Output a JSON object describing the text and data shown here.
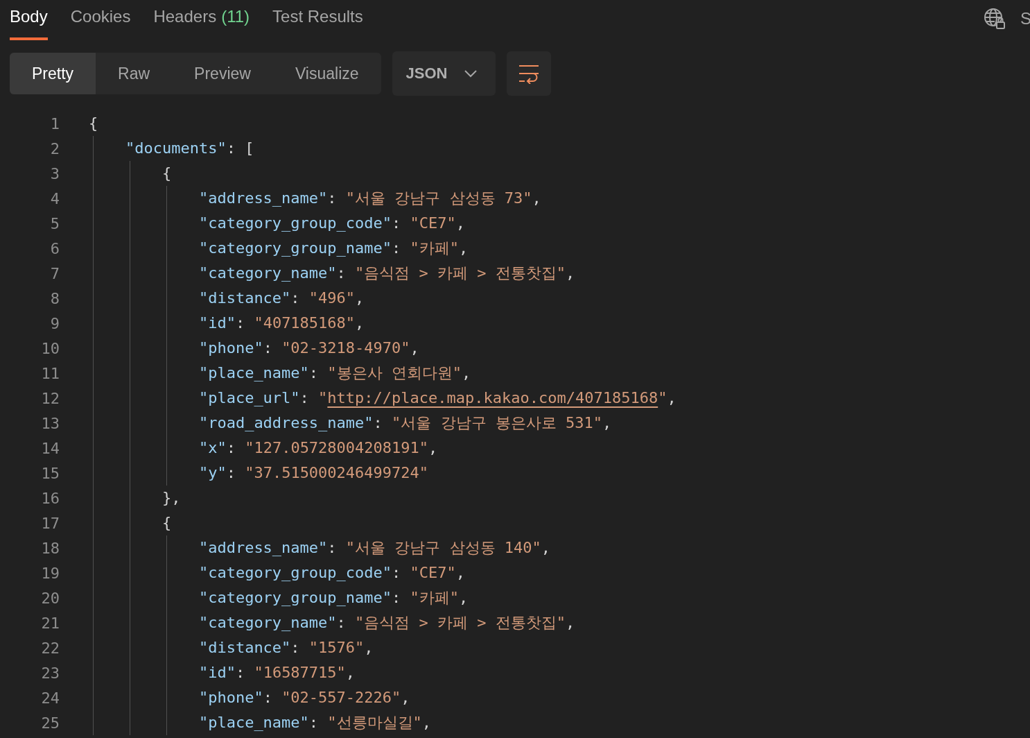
{
  "response_tabs": [
    {
      "label": "Body",
      "selected": true
    },
    {
      "label": "Cookies",
      "selected": false
    },
    {
      "label": "Headers",
      "count": "(11)",
      "selected": false
    },
    {
      "label": "Test Results",
      "selected": false
    }
  ],
  "right_text": "S",
  "view_modes": [
    {
      "label": "Pretty",
      "selected": true
    },
    {
      "label": "Raw",
      "selected": false
    },
    {
      "label": "Preview",
      "selected": false
    },
    {
      "label": "Visualize",
      "selected": false
    }
  ],
  "format_dropdown": {
    "value": "JSON"
  },
  "code_lines": [
    {
      "number": "1",
      "tokens": [
        {
          "kind": "punct",
          "text": "{"
        }
      ],
      "children": [
        {
          "number": "2",
          "tokens": [
            {
              "kind": "key",
              "text": "\"documents\""
            },
            {
              "kind": "punct",
              "text": ": ["
            }
          ],
          "children": [
            {
              "number": "3",
              "tokens": [
                {
                  "kind": "punct",
                  "text": "{"
                }
              ],
              "children": [
                {
                  "number": "4",
                  "tokens": [
                    {
                      "kind": "key",
                      "text": "\"address_name\""
                    },
                    {
                      "kind": "punct",
                      "text": ": "
                    },
                    {
                      "kind": "string",
                      "text": "\"서울 강남구 삼성동 73\""
                    },
                    {
                      "kind": "punct",
                      "text": ","
                    }
                  ]
                },
                {
                  "number": "5",
                  "tokens": [
                    {
                      "kind": "key",
                      "text": "\"category_group_code\""
                    },
                    {
                      "kind": "punct",
                      "text": ": "
                    },
                    {
                      "kind": "string",
                      "text": "\"CE7\""
                    },
                    {
                      "kind": "punct",
                      "text": ","
                    }
                  ]
                },
                {
                  "number": "6",
                  "tokens": [
                    {
                      "kind": "key",
                      "text": "\"category_group_name\""
                    },
                    {
                      "kind": "punct",
                      "text": ": "
                    },
                    {
                      "kind": "string",
                      "text": "\"카페\""
                    },
                    {
                      "kind": "punct",
                      "text": ","
                    }
                  ]
                },
                {
                  "number": "7",
                  "tokens": [
                    {
                      "kind": "key",
                      "text": "\"category_name\""
                    },
                    {
                      "kind": "punct",
                      "text": ": "
                    },
                    {
                      "kind": "string",
                      "text": "\"음식점 > 카페 > 전통찻집\""
                    },
                    {
                      "kind": "punct",
                      "text": ","
                    }
                  ]
                },
                {
                  "number": "8",
                  "tokens": [
                    {
                      "kind": "key",
                      "text": "\"distance\""
                    },
                    {
                      "kind": "punct",
                      "text": ": "
                    },
                    {
                      "kind": "string",
                      "text": "\"496\""
                    },
                    {
                      "kind": "punct",
                      "text": ","
                    }
                  ]
                },
                {
                  "number": "9",
                  "tokens": [
                    {
                      "kind": "key",
                      "text": "\"id\""
                    },
                    {
                      "kind": "punct",
                      "text": ": "
                    },
                    {
                      "kind": "string",
                      "text": "\"407185168\""
                    },
                    {
                      "kind": "punct",
                      "text": ","
                    }
                  ]
                },
                {
                  "number": "10",
                  "tokens": [
                    {
                      "kind": "key",
                      "text": "\"phone\""
                    },
                    {
                      "kind": "punct",
                      "text": ": "
                    },
                    {
                      "kind": "string",
                      "text": "\"02-3218-4970\""
                    },
                    {
                      "kind": "punct",
                      "text": ","
                    }
                  ]
                },
                {
                  "number": "11",
                  "tokens": [
                    {
                      "kind": "key",
                      "text": "\"place_name\""
                    },
                    {
                      "kind": "punct",
                      "text": ": "
                    },
                    {
                      "kind": "string",
                      "text": "\"봉은사 연회다원\""
                    },
                    {
                      "kind": "punct",
                      "text": ","
                    }
                  ]
                },
                {
                  "number": "12",
                  "tokens": [
                    {
                      "kind": "key",
                      "text": "\"place_url\""
                    },
                    {
                      "kind": "punct",
                      "text": ": "
                    },
                    {
                      "kind": "string",
                      "text": "\""
                    },
                    {
                      "kind": "link",
                      "text": "http://place.map.kakao.com/407185168"
                    },
                    {
                      "kind": "string",
                      "text": "\""
                    },
                    {
                      "kind": "punct",
                      "text": ","
                    }
                  ]
                },
                {
                  "number": "13",
                  "tokens": [
                    {
                      "kind": "key",
                      "text": "\"road_address_name\""
                    },
                    {
                      "kind": "punct",
                      "text": ": "
                    },
                    {
                      "kind": "string",
                      "text": "\"서울 강남구 봉은사로 531\""
                    },
                    {
                      "kind": "punct",
                      "text": ","
                    }
                  ]
                },
                {
                  "number": "14",
                  "tokens": [
                    {
                      "kind": "key",
                      "text": "\"x\""
                    },
                    {
                      "kind": "punct",
                      "text": ": "
                    },
                    {
                      "kind": "string",
                      "text": "\"127.05728004208191\""
                    },
                    {
                      "kind": "punct",
                      "text": ","
                    }
                  ]
                },
                {
                  "number": "15",
                  "tokens": [
                    {
                      "kind": "key",
                      "text": "\"y\""
                    },
                    {
                      "kind": "punct",
                      "text": ": "
                    },
                    {
                      "kind": "string",
                      "text": "\"37.515000246499724\""
                    }
                  ]
                }
              ]
            },
            {
              "number": "16",
              "tokens": [
                {
                  "kind": "punct",
                  "text": "},"
                }
              ]
            },
            {
              "number": "17",
              "tokens": [
                {
                  "kind": "punct",
                  "text": "{"
                }
              ],
              "children": [
                {
                  "number": "18",
                  "tokens": [
                    {
                      "kind": "key",
                      "text": "\"address_name\""
                    },
                    {
                      "kind": "punct",
                      "text": ": "
                    },
                    {
                      "kind": "string",
                      "text": "\"서울 강남구 삼성동 140\""
                    },
                    {
                      "kind": "punct",
                      "text": ","
                    }
                  ]
                },
                {
                  "number": "19",
                  "tokens": [
                    {
                      "kind": "key",
                      "text": "\"category_group_code\""
                    },
                    {
                      "kind": "punct",
                      "text": ": "
                    },
                    {
                      "kind": "string",
                      "text": "\"CE7\""
                    },
                    {
                      "kind": "punct",
                      "text": ","
                    }
                  ]
                },
                {
                  "number": "20",
                  "tokens": [
                    {
                      "kind": "key",
                      "text": "\"category_group_name\""
                    },
                    {
                      "kind": "punct",
                      "text": ": "
                    },
                    {
                      "kind": "string",
                      "text": "\"카페\""
                    },
                    {
                      "kind": "punct",
                      "text": ","
                    }
                  ]
                },
                {
                  "number": "21",
                  "tokens": [
                    {
                      "kind": "key",
                      "text": "\"category_name\""
                    },
                    {
                      "kind": "punct",
                      "text": ": "
                    },
                    {
                      "kind": "string",
                      "text": "\"음식점 > 카페 > 전통찻집\""
                    },
                    {
                      "kind": "punct",
                      "text": ","
                    }
                  ]
                },
                {
                  "number": "22",
                  "tokens": [
                    {
                      "kind": "key",
                      "text": "\"distance\""
                    },
                    {
                      "kind": "punct",
                      "text": ": "
                    },
                    {
                      "kind": "string",
                      "text": "\"1576\""
                    },
                    {
                      "kind": "punct",
                      "text": ","
                    }
                  ]
                },
                {
                  "number": "23",
                  "tokens": [
                    {
                      "kind": "key",
                      "text": "\"id\""
                    },
                    {
                      "kind": "punct",
                      "text": ": "
                    },
                    {
                      "kind": "string",
                      "text": "\"16587715\""
                    },
                    {
                      "kind": "punct",
                      "text": ","
                    }
                  ]
                },
                {
                  "number": "24",
                  "tokens": [
                    {
                      "kind": "key",
                      "text": "\"phone\""
                    },
                    {
                      "kind": "punct",
                      "text": ": "
                    },
                    {
                      "kind": "string",
                      "text": "\"02-557-2226\""
                    },
                    {
                      "kind": "punct",
                      "text": ","
                    }
                  ]
                },
                {
                  "number": "25",
                  "tokens": [
                    {
                      "kind": "key",
                      "text": "\"place_name\""
                    },
                    {
                      "kind": "punct",
                      "text": ": "
                    },
                    {
                      "kind": "string",
                      "text": "\"선릉마실길\""
                    },
                    {
                      "kind": "punct",
                      "text": ","
                    }
                  ]
                }
              ]
            }
          ]
        }
      ]
    }
  ]
}
